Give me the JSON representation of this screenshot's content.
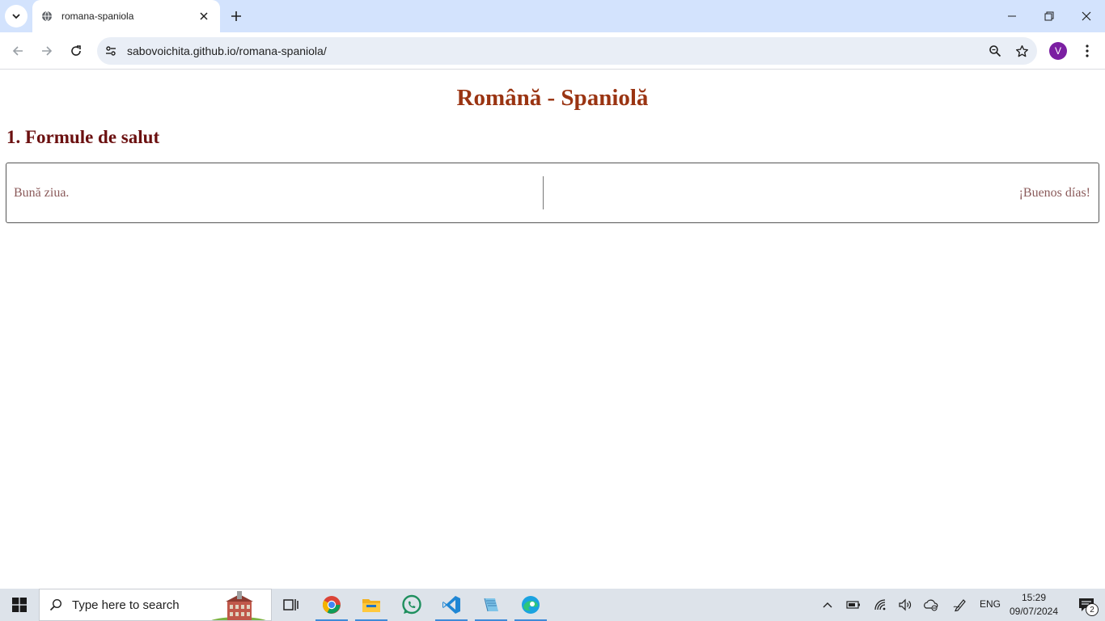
{
  "browser": {
    "tab_title": "romana-spaniola",
    "url": "sabovoichita.github.io/romana-spaniola/",
    "profile_initial": "V",
    "accent_color": "#d3e3fd"
  },
  "page": {
    "title": "Română - Spaniolă",
    "sections": [
      {
        "heading": "1. Formule de salut",
        "phrases": [
          {
            "ro": "Bună ziua.",
            "es": "¡Buenos días!"
          }
        ]
      }
    ],
    "title_color": "#9a3412",
    "heading_color": "#6b1010",
    "phrase_color": "#8a5a5a"
  },
  "taskbar": {
    "search_placeholder": "Type here to search",
    "apps": [
      "task-view",
      "chrome",
      "file-explorer",
      "whatsapp",
      "vscode",
      "notepad",
      "edge"
    ],
    "language": "ENG",
    "time": "15:29",
    "date": "09/07/2024",
    "notification_count": "2"
  }
}
